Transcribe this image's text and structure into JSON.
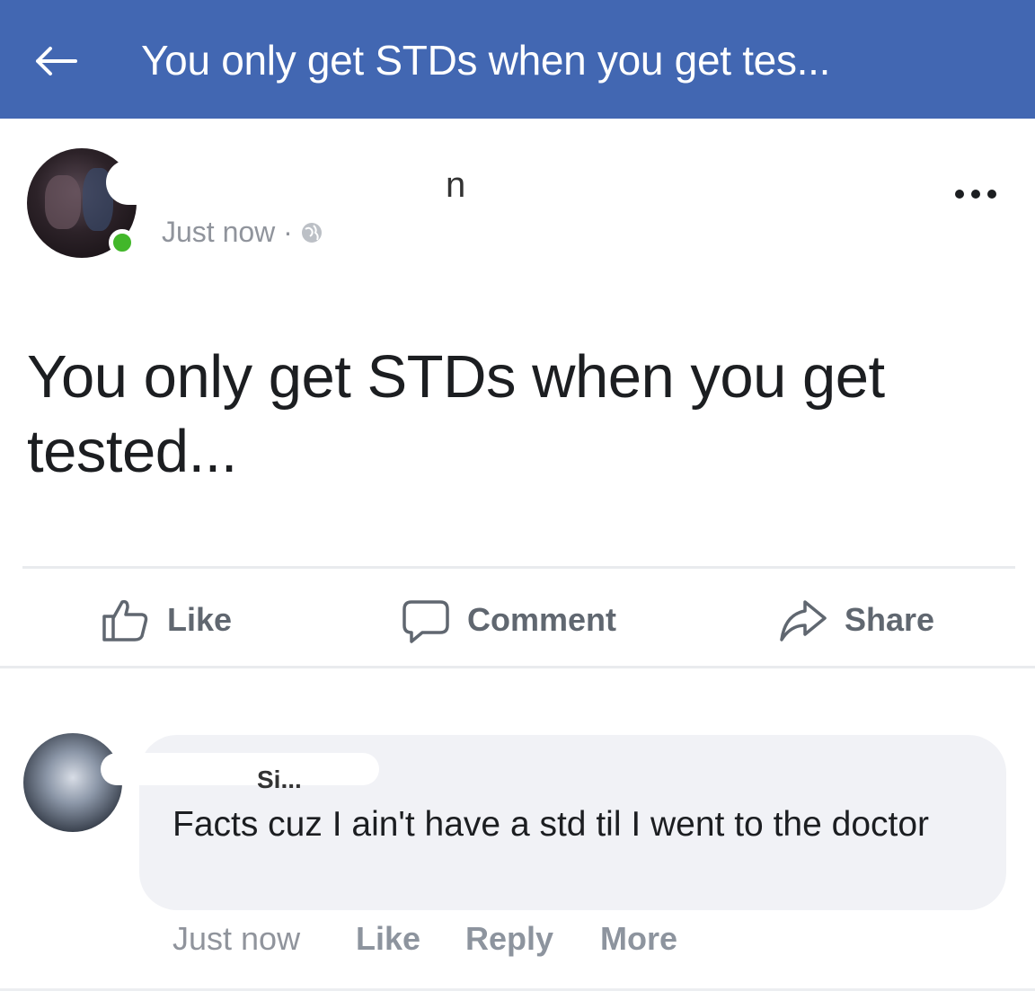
{
  "header": {
    "title": "You only get STDs when you get tes...",
    "color": "#4267b2"
  },
  "post": {
    "author_name_partial": "n",
    "time": "Just now ·",
    "text": "You only get STDs when you get tested...",
    "actions": {
      "like": "Like",
      "comment": "Comment",
      "share": "Share"
    }
  },
  "comment": {
    "author_name_partial": "Si...",
    "text": "Facts cuz I ain't have a std til I went to the doctor",
    "time": "Just now",
    "like": "Like",
    "reply": "Reply",
    "more": "More"
  },
  "icons": [
    "back-arrow-icon",
    "globe-icon",
    "more-dots-icon",
    "like-thumb-icon",
    "comment-bubble-icon",
    "share-arrow-icon"
  ],
  "colors": {
    "online": "#42b72a",
    "meta_text": "#90949c",
    "action_text": "#606770",
    "comment_bubble": "#f1f2f6"
  }
}
